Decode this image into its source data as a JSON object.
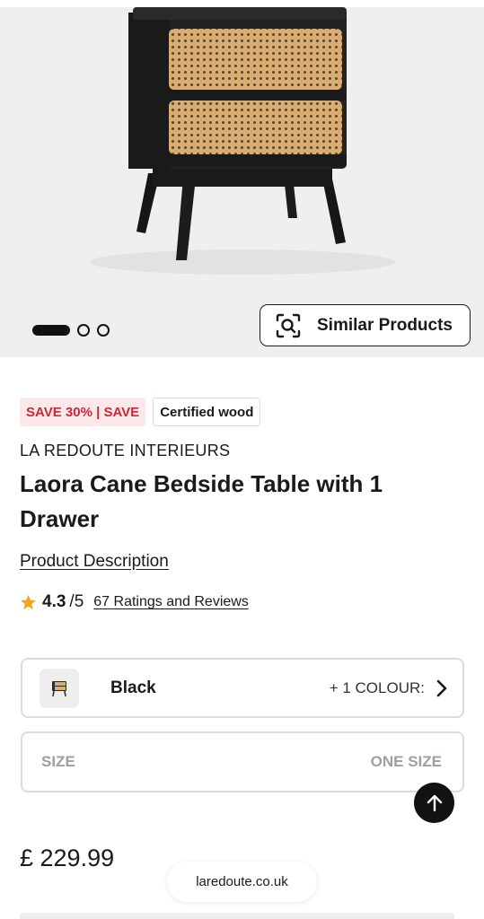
{
  "carousel": {
    "similar_products_label": "Similar Products",
    "slide_count": 3,
    "active_slide": 1
  },
  "badges": {
    "sale": "SAVE 30% | SAVE",
    "certified": "Certified wood"
  },
  "product": {
    "brand": "LA REDOUTE INTERIEURS",
    "title": "Laora Cane Bedside Table with 1 Drawer",
    "description_link": "Product Description",
    "rating_value": "4.3",
    "rating_max": "/5",
    "reviews_link": "67 Ratings and Reviews",
    "price": "£ 229.99"
  },
  "colour_selector": {
    "selected": "Black",
    "more_colours": "+ 1 COLOUR:"
  },
  "size_selector": {
    "label": "SIZE",
    "value": "ONE SIZE"
  },
  "browser": {
    "url": "laredoute.co.uk"
  },
  "colors": {
    "sale_text": "#c8283a",
    "sale_bg": "#fbe9ea",
    "star": "#f2a71b",
    "muted": "#9aa0a6"
  },
  "icons": [
    "visual-search-icon",
    "star-icon",
    "chevron-right-icon",
    "arrow-up-icon",
    "product-thumbnail-icon"
  ]
}
